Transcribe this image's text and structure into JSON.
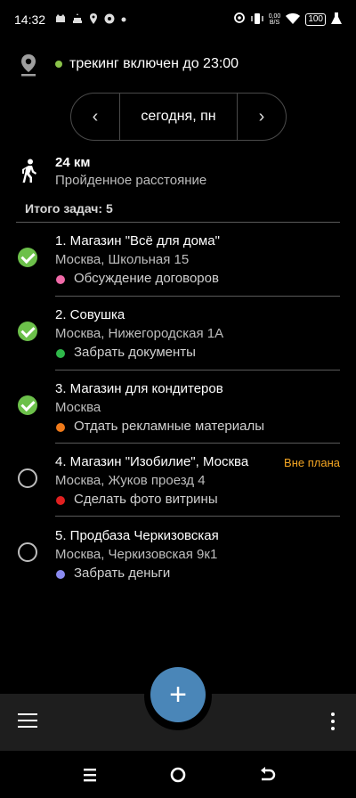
{
  "status_bar": {
    "time": "14:32",
    "speed_value": "0,00",
    "speed_unit": "B/S",
    "battery": "100"
  },
  "tracking": {
    "text": "трекинг включен до 23:00",
    "dot_color": "#8bc34a"
  },
  "date_nav": {
    "prev_icon": "‹",
    "label": "сегодня, пн",
    "next_icon": "›"
  },
  "distance": {
    "value": "24 км",
    "label": "Пройденное расстояние"
  },
  "tasks_total": "Итого задач: 5",
  "tasks": [
    {
      "title": "1.  Магазин \"Всё для дома\"",
      "address": "Москва, Школьная 15",
      "action": "Обсуждение договоров",
      "color": "#f06aa8",
      "done": true,
      "badge": ""
    },
    {
      "title": "2.  Совушка",
      "address": "Москва, Нижегородская 1А",
      "action": "Забрать документы",
      "color": "#2fb84a",
      "done": true,
      "badge": ""
    },
    {
      "title": "3.  Магазин для кондитеров",
      "address": "Москва",
      "action": "Отдать рекламные материалы",
      "color": "#f07a1a",
      "done": true,
      "badge": ""
    },
    {
      "title": "4.  Магазин \"Изобилие\", Москва",
      "address": "Москва, Жуков проезд 4",
      "action": "Сделать фото витрины",
      "color": "#e02020",
      "done": false,
      "badge": "Вне плана"
    },
    {
      "title": "5.  Продбаза Черкизовская",
      "address": "Москва, Черкизовская 9к1",
      "action": "Забрать деньги",
      "color": "#8a8af0",
      "done": false,
      "badge": ""
    }
  ],
  "fab": {
    "label": "+"
  },
  "colors": {
    "accent": "#4a86b8",
    "done": "#6cc04a",
    "badge": "#f5a623"
  }
}
